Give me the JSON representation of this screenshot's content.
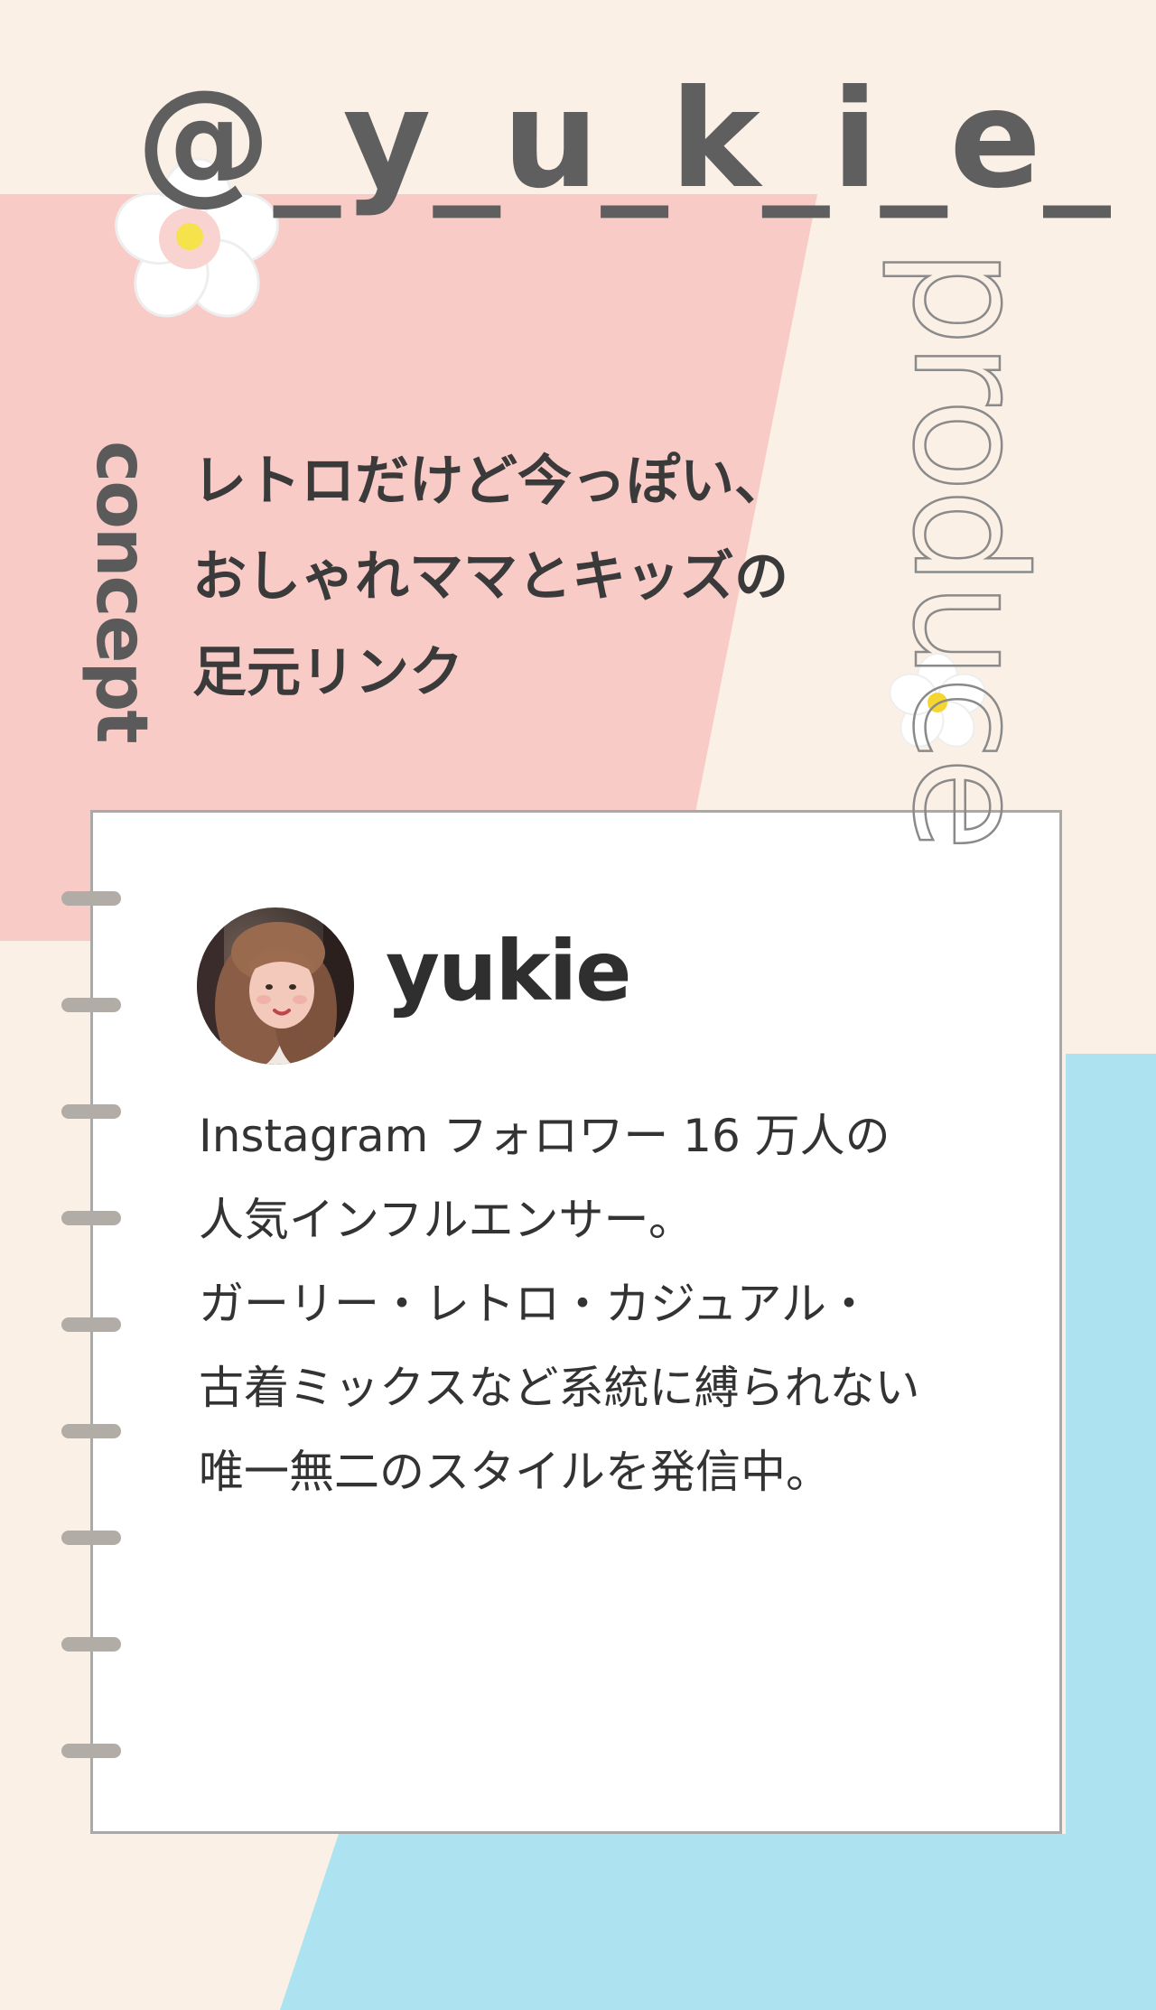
{
  "handle": "@_y_u_k_i_e_",
  "produce_label": "produce",
  "concept_label": "concept",
  "tagline": {
    "lines": [
      "レトロだけど今っぽい、",
      "おしゃれママとキッズの",
      "足元リンク"
    ]
  },
  "profile": {
    "name": "yukie",
    "bio": [
      "Instagram フォロワー 16 万人の",
      "人気インフルエンサー。",
      "ガーリー・レトロ・カジュアル・",
      "古着ミックスなど系統に縛られない",
      "唯一無二のスタイルを発信中。"
    ]
  },
  "colors": {
    "background": "#fbf0e6",
    "pink": "#f8cbc6",
    "blue": "#ade3f0",
    "text_dark": "#333333",
    "handle_gray": "#5f5f5f"
  },
  "icons": [
    "flower-icon",
    "flower-icon-small",
    "avatar-photo"
  ]
}
